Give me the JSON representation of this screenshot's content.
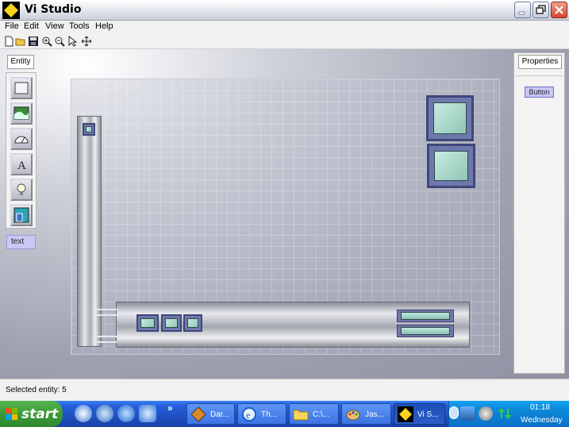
{
  "window": {
    "title": "Vi Studio",
    "buttons": [
      "minimize",
      "restore",
      "close"
    ]
  },
  "menu": {
    "items": [
      "File",
      "Edit",
      "View",
      "Tools",
      "Help"
    ]
  },
  "toolbar": {
    "icons": [
      "new-file-icon",
      "open-folder-icon",
      "save-icon",
      "zoom-in-icon",
      "zoom-out-icon",
      "select-pointer-icon",
      "move-icon"
    ]
  },
  "palette": {
    "tab_label": "Entity",
    "tools": [
      "rectangle-tool-icon",
      "image-tool-icon",
      "gauge-tool-icon",
      "text-tool-icon",
      "lightbulb-tool-icon",
      "container-tool-icon"
    ],
    "selected_label": "text"
  },
  "properties": {
    "tab_label": "Properties",
    "selected_type": "Button"
  },
  "status": {
    "text": "Selected entity: 5"
  },
  "taskbar": {
    "start_label": "start",
    "overflow": "»",
    "tasks": [
      {
        "label": "Dar...",
        "icon": "app-icon"
      },
      {
        "label": "Th...",
        "icon": "ie-icon"
      },
      {
        "label": "C:\\...",
        "icon": "folder-icon"
      },
      {
        "label": "Jas...",
        "icon": "paint-icon"
      },
      {
        "label": "Vi S...",
        "icon": "vi-studio-icon"
      }
    ],
    "clock": "01:18",
    "day": "Wednesday"
  },
  "colors": {
    "accent_button": "#8fc6b7",
    "selection_tag": "#c8c8f4",
    "taskbar": "#245edb"
  }
}
